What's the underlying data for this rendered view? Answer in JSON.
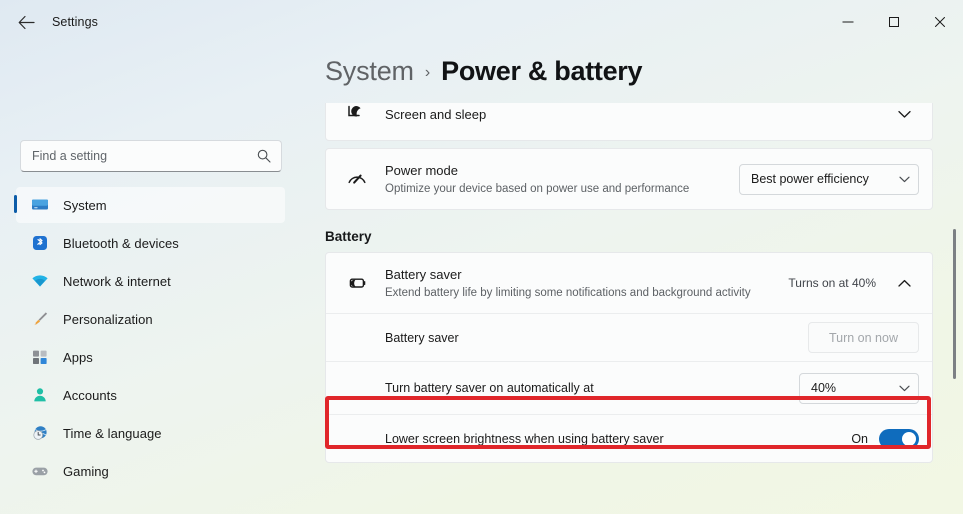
{
  "window": {
    "title": "Settings",
    "back_icon": "back-arrow-icon",
    "minimize_label": "–",
    "maximize_label": "□",
    "close_label": "✕"
  },
  "search": {
    "placeholder": "Find a setting",
    "value": "",
    "icon": "search-icon"
  },
  "sidebar": {
    "items": [
      {
        "label": "System",
        "icon": "monitor-icon",
        "selected": true
      },
      {
        "label": "Bluetooth & devices",
        "icon": "bluetooth-icon",
        "selected": false
      },
      {
        "label": "Network & internet",
        "icon": "wifi-icon",
        "selected": false
      },
      {
        "label": "Personalization",
        "icon": "paintbrush-icon",
        "selected": false
      },
      {
        "label": "Apps",
        "icon": "apps-icon",
        "selected": false
      },
      {
        "label": "Accounts",
        "icon": "person-icon",
        "selected": false
      },
      {
        "label": "Time & language",
        "icon": "clock-globe-icon",
        "selected": false
      },
      {
        "label": "Gaming",
        "icon": "gamepad-icon",
        "selected": false
      }
    ]
  },
  "breadcrumb": {
    "parent": "System",
    "separator": "›",
    "current": "Power & battery"
  },
  "main": {
    "screen_and_sleep": {
      "title": "Screen and sleep",
      "icon": "monitor-moon-icon",
      "chevron": "chevron-down-icon"
    },
    "power_mode": {
      "title": "Power mode",
      "subtitle": "Optimize your device based on power use and performance",
      "icon": "speedometer-icon",
      "value": "Best power efficiency",
      "chevron": "chevron-down-icon"
    },
    "battery_section_title": "Battery",
    "battery_saver": {
      "title": "Battery saver",
      "subtitle": "Extend battery life by limiting some notifications and background activity",
      "icon": "battery-saver-icon",
      "status": "Turns on at 40%",
      "chevron": "chevron-up-icon"
    },
    "battery_saver_row": {
      "label": "Battery saver",
      "button_label": "Turn on now",
      "button_enabled": false
    },
    "auto_threshold_row": {
      "label": "Turn battery saver on automatically at",
      "value": "40%",
      "chevron": "chevron-down-icon",
      "highlighted": true
    },
    "lower_brightness_row": {
      "label": "Lower screen brightness when using battery saver",
      "toggle_state": "On"
    }
  },
  "colors": {
    "accent": "#0f6cbd",
    "selection_bar": "#0c5ca8",
    "highlight_box": "#e0262a",
    "card_bg": "#fbfcfc"
  }
}
